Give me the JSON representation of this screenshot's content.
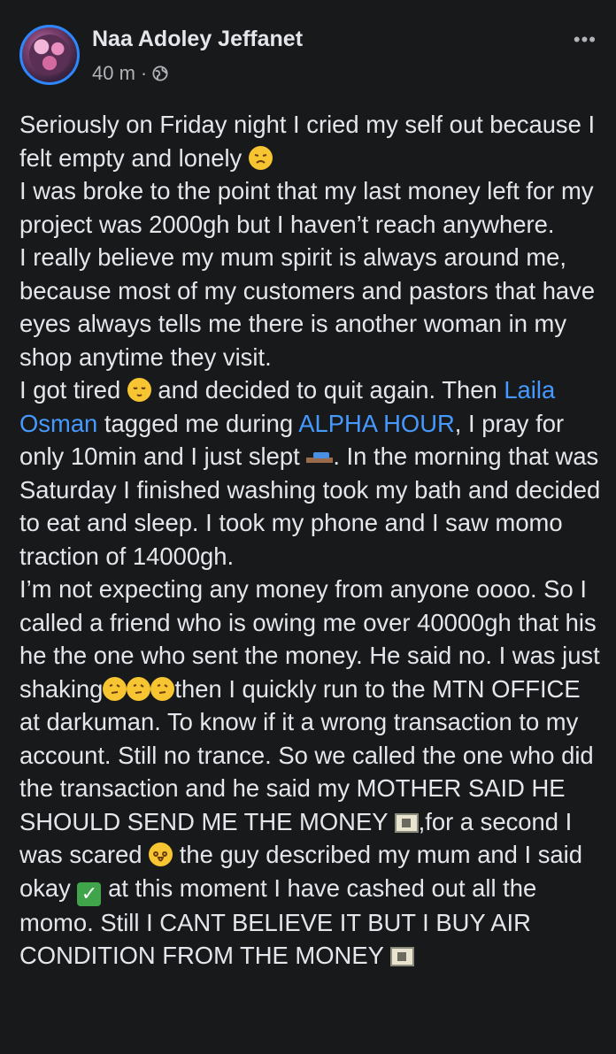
{
  "post": {
    "author": "Naa Adoley Jeffanet",
    "time": "40 m",
    "separator": "·",
    "more_label": "•••",
    "icons": {
      "globe": "globe-icon",
      "more": "more-options-icon"
    },
    "paragraphs": [
      {
        "segments": [
          {
            "t": "Seriously on Friday night I cried my self out because I felt empty and lonely "
          },
          {
            "e": "weary-face"
          }
        ]
      },
      {
        "segments": [
          {
            "t": "I was broke to the point that my last money left for my project was 2000gh but I haven’t  reach anywhere."
          }
        ]
      },
      {
        "segments": [
          {
            "t": "I really believe my mum spirit is always around me, because most of my customers and pastors that have eyes always tells me there is another woman in my shop anytime they visit."
          }
        ]
      },
      {
        "segments": [
          {
            "t": "I got tired "
          },
          {
            "e": "sleeping-face"
          },
          {
            "t": " and decided to quit again. Then "
          },
          {
            "l": "Laila Osman"
          },
          {
            "t": " tagged me during "
          },
          {
            "l": "ALPHA HOUR"
          },
          {
            "t": ", I pray for only 10min and I just slept "
          },
          {
            "e": "bed"
          },
          {
            "t": ". In the morning that was Saturday I finished washing took my bath and decided to eat and sleep. I took my phone and I saw momo traction of 14000gh."
          }
        ]
      },
      {
        "segments": [
          {
            "t": "I’m not expecting any money from anyone oooo. So I called a friend who is owing me over 40000gh that his he the one who sent the money. He said no. I was just shaking"
          },
          {
            "e": "thinking-face"
          },
          {
            "e": "thinking-face"
          },
          {
            "e": "thinking-face"
          },
          {
            "t": "then I quickly run to the MTN OFFICE at darkuman. To know if it a wrong transaction to my account. Still no trance. So we called the one who did the transaction and he said my MOTHER SAID HE SHOULD SEND ME THE MONEY "
          },
          {
            "e": "yen-banknote"
          },
          {
            "t": ",for a second I was scared "
          },
          {
            "e": "screaming-face"
          },
          {
            "t": " the guy described my mum and I said okay "
          },
          {
            "e": "check-mark"
          },
          {
            "t": " at this moment I have cashed out all the momo. Still I CANT BELIEVE IT BUT I BUY AIR CONDITION FROM THE MONEY "
          },
          {
            "e": "yen-banknote"
          }
        ]
      }
    ]
  },
  "colors": {
    "background": "#18191a",
    "text": "#e4e6eb",
    "secondary": "#b0b3b8",
    "link": "#4599ff",
    "avatar_ring": "#2d88ff"
  }
}
